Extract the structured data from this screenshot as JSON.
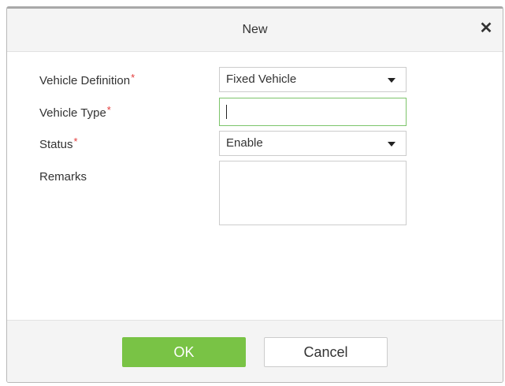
{
  "dialog": {
    "title": "New",
    "close_icon": "close-icon",
    "close_glyph": "✕"
  },
  "form": {
    "vehicle_definition": {
      "label": "Vehicle Definition",
      "required_mark": "*",
      "value": "Fixed Vehicle"
    },
    "vehicle_type": {
      "label": "Vehicle Type",
      "required_mark": "*",
      "value": ""
    },
    "status": {
      "label": "Status",
      "required_mark": "*",
      "value": "Enable"
    },
    "remarks": {
      "label": "Remarks",
      "value": ""
    }
  },
  "buttons": {
    "ok": "OK",
    "cancel": "Cancel"
  },
  "colors": {
    "accent_green": "#79c345",
    "required_red": "#e33b3b",
    "focus_border": "#7cc46a"
  }
}
